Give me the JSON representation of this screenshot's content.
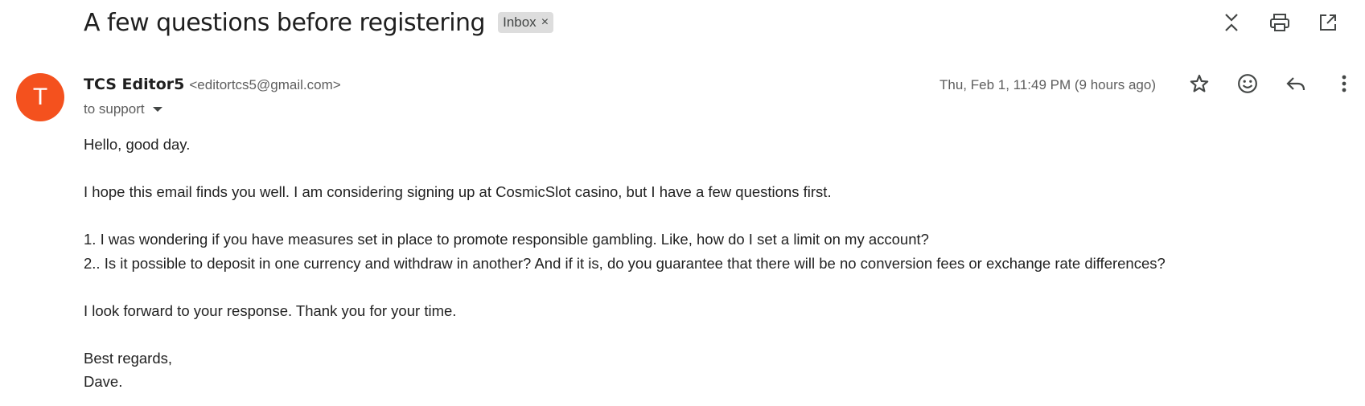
{
  "email": {
    "subject": "A few questions before registering",
    "label": "Inbox",
    "label_remove": "×",
    "sender": {
      "avatar_letter": "T",
      "avatar_color": "#f4511e",
      "name": "TCS Editor5",
      "email": "<editortcs5@gmail.com>"
    },
    "recipient": "to support",
    "date": "Thu, Feb 1, 11:49 PM (9 hours ago)",
    "body": {
      "greeting": "Hello, good day.",
      "intro": "I hope this email finds you well. I am considering signing up at  CosmicSlot casino, but I have a few questions first.",
      "q1": "1. I was wondering if you have measures set in place to promote responsible gambling. Like, how do I set a limit on my account?",
      "q2": "2.. Is it possible to deposit in one currency and withdraw in another? And if it is, do you guarantee that there will be no conversion fees or exchange rate differences?",
      "closing": "I look forward to your response. Thank you for your time.",
      "signoff": "Best regards,",
      "signature": "Dave."
    }
  },
  "toolbar": {
    "top_icons": [
      "collapse-all-icon",
      "print-icon",
      "open-in-new-window-icon"
    ],
    "message_icons": [
      "star-icon",
      "emoji-icon",
      "reply-icon",
      "more-vert-icon"
    ]
  }
}
